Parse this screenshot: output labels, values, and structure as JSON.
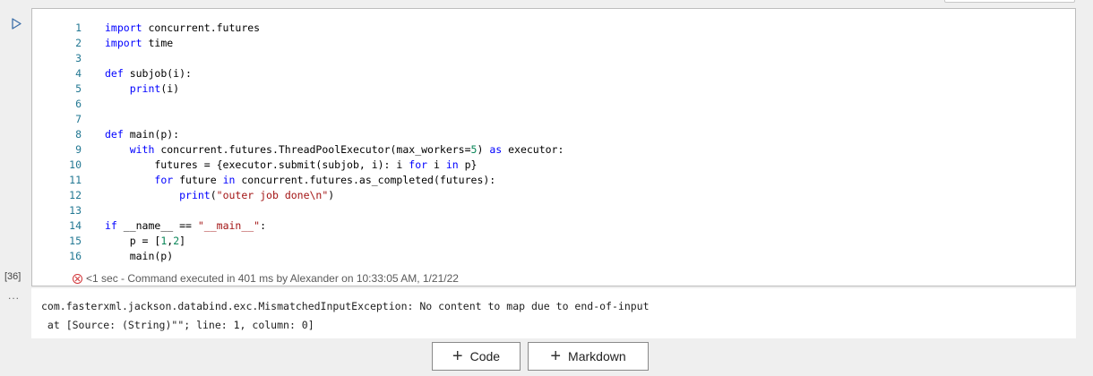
{
  "cell": {
    "execution_count": "[36]",
    "more_label": "...",
    "run_icon": "play-triangle-icon",
    "code_lines": [
      {
        "n": "1",
        "html": "<span class=\"kw\">import</span> concurrent.futures"
      },
      {
        "n": "2",
        "html": "<span class=\"kw\">import</span> time"
      },
      {
        "n": "3",
        "html": ""
      },
      {
        "n": "4",
        "html": "<span class=\"kw\">def</span> subjob(i):"
      },
      {
        "n": "5",
        "html": "    <span class=\"fn\">print</span>(i)"
      },
      {
        "n": "6",
        "html": ""
      },
      {
        "n": "7",
        "html": ""
      },
      {
        "n": "8",
        "html": "<span class=\"kw\">def</span> main(p):"
      },
      {
        "n": "9",
        "html": "    <span class=\"kw\">with</span> concurrent.futures.ThreadPoolExecutor(max_workers=<span class=\"num\">5</span>) <span class=\"kw\">as</span> executor:"
      },
      {
        "n": "10",
        "html": "        futures = {executor.submit(subjob, i): i <span class=\"kw\">for</span> i <span class=\"kw\">in</span> p}"
      },
      {
        "n": "11",
        "html": "        <span class=\"kw\">for</span> future <span class=\"kw\">in</span> concurrent.futures.as_completed(futures):"
      },
      {
        "n": "12",
        "html": "            <span class=\"fn\">print</span>(<span class=\"str\">\"outer job done\\n\"</span>)"
      },
      {
        "n": "13",
        "html": ""
      },
      {
        "n": "14",
        "html": "<span class=\"kw\">if</span> __name__ == <span class=\"str\">\"__main__\"</span>:"
      },
      {
        "n": "15",
        "html": "    p = [<span class=\"num\">1</span>,<span class=\"num\">2</span>]"
      },
      {
        "n": "16",
        "html": "    main(p)"
      }
    ],
    "status": {
      "icon": "error-circle-icon",
      "text": "<1 sec - Command executed in 401 ms by Alexander on 10:33:05 AM, 1/21/22"
    },
    "output_lines": [
      "com.fasterxml.jackson.databind.exc.MismatchedInputException: No content to map due to end-of-input",
      " at [Source: (String)\"\"; line: 1, column: 0]"
    ]
  },
  "toolbar": {
    "add_code_label": "Code",
    "add_markdown_label": "Markdown"
  },
  "colors": {
    "keyword": "#0000ff",
    "line_number": "#237893",
    "string": "#a31515",
    "number": "#098658",
    "error": "#d13438"
  }
}
